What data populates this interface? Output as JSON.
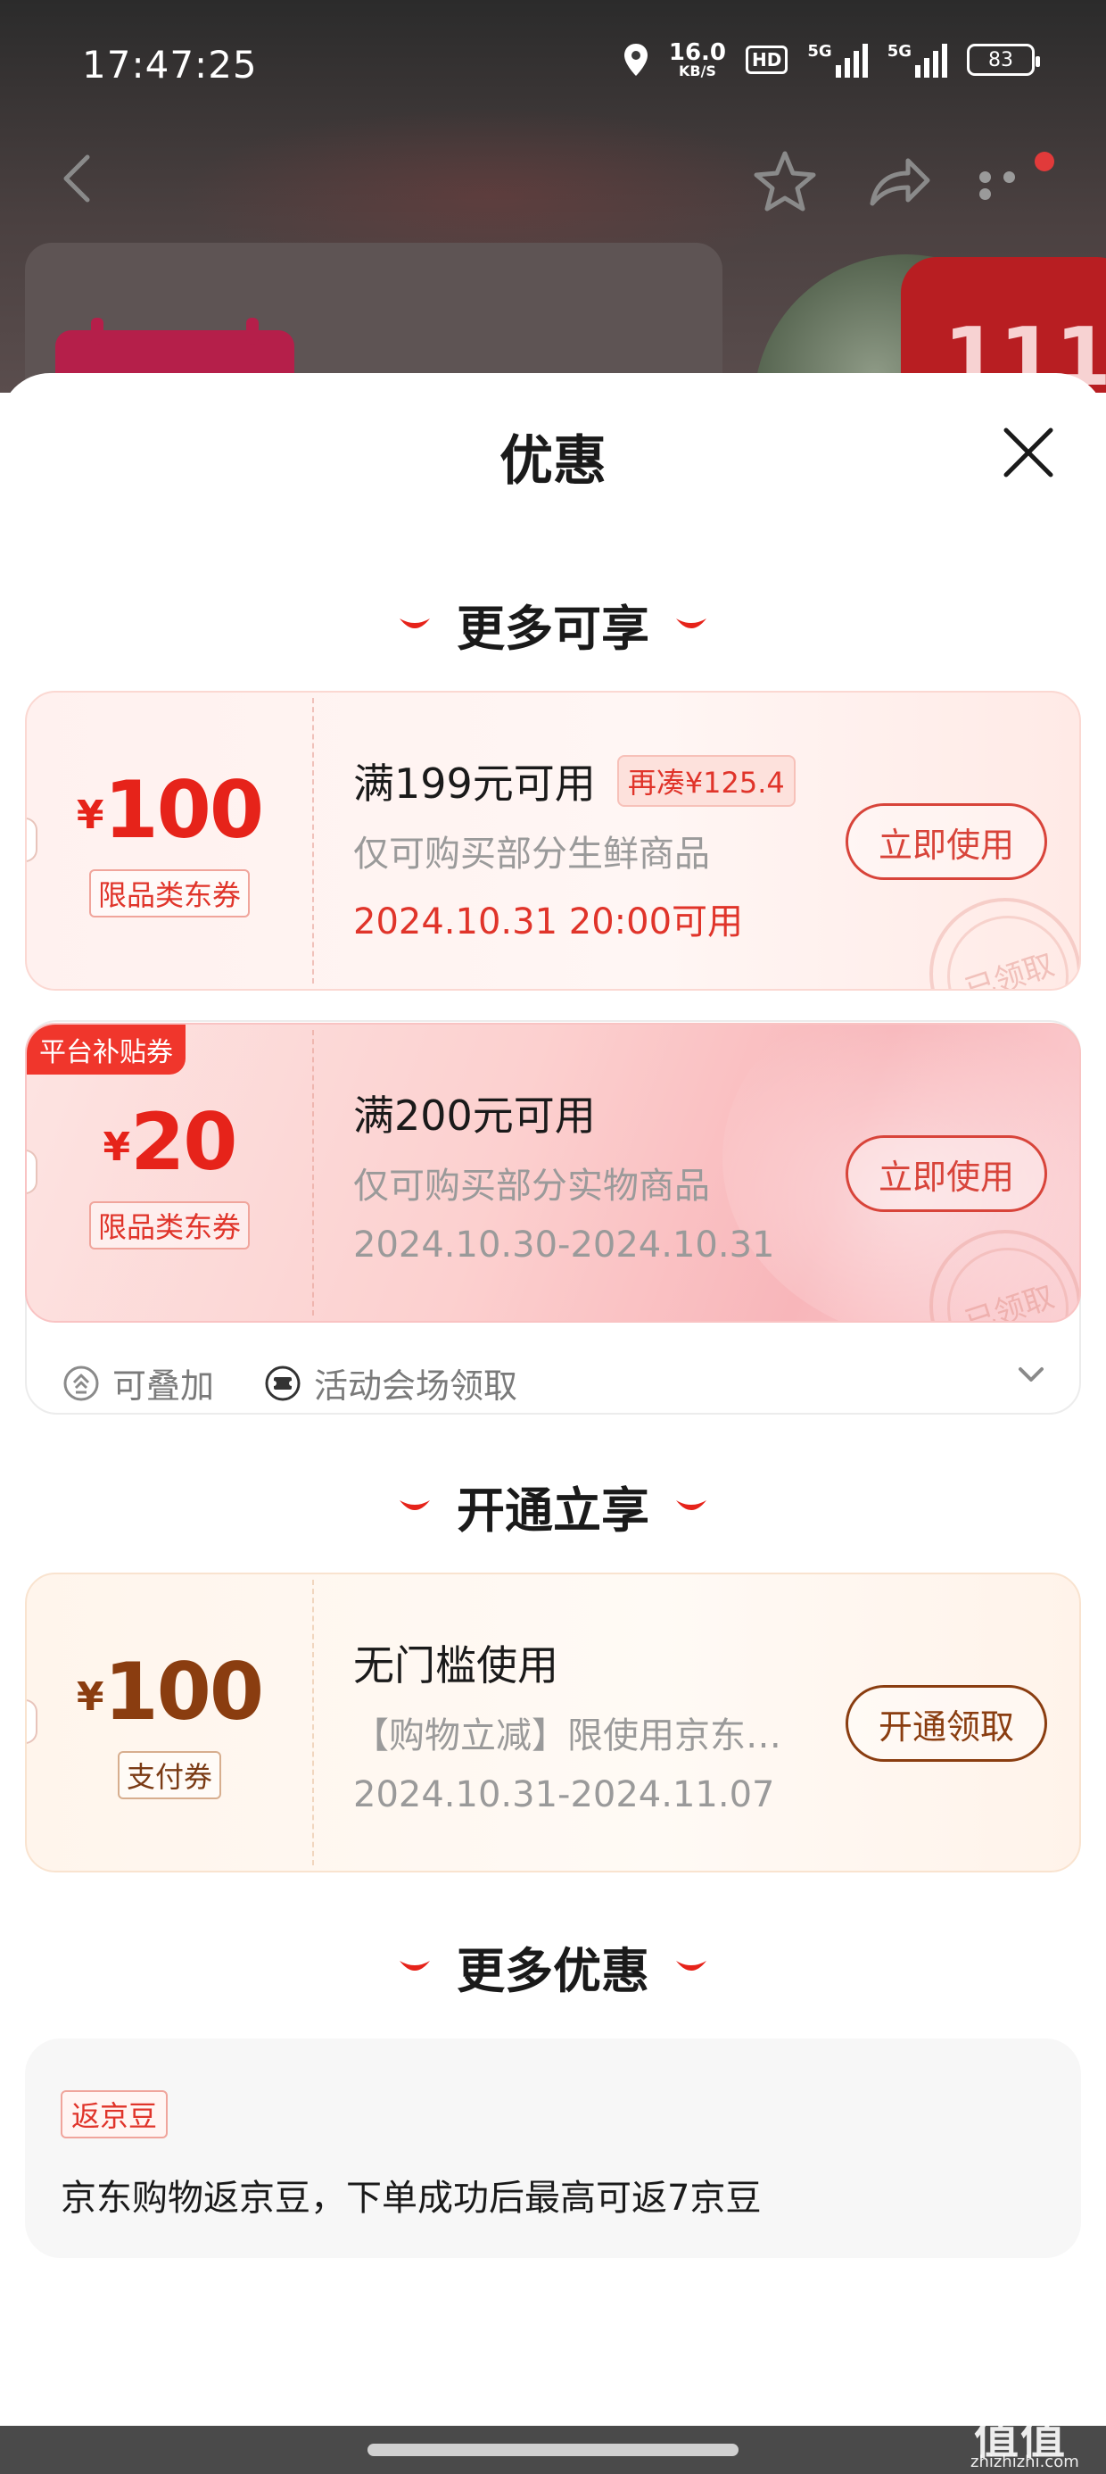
{
  "status_bar": {
    "time": "17:47:25",
    "net_speed_value": "16.0",
    "net_speed_unit": "KB/S",
    "hd": "HD",
    "signal1": "5G",
    "signal2": "5G",
    "battery": "83"
  },
  "background": {
    "promo_logo_text": "111"
  },
  "sheet": {
    "title": "优惠"
  },
  "sections": {
    "more_available": "更多可享",
    "open_enjoy": "开通立享",
    "more_discounts": "更多优惠"
  },
  "coupons": [
    {
      "yen": "¥",
      "amount": "100",
      "type": "限品类东券",
      "title": "满199元可用",
      "extra": "再凑¥125.4",
      "desc": "仅可购买部分生鲜商品",
      "date": "2024.10.31 20:00可用",
      "button": "立即使用",
      "stamp": "已领取"
    },
    {
      "corner_tag": "平台补贴券",
      "yen": "¥",
      "amount": "20",
      "type": "限品类东券",
      "title": "满200元可用",
      "desc": "仅可购买部分实物商品",
      "date": "2024.10.30-2024.10.31",
      "button": "立即使用",
      "stamp": "已领取"
    },
    {
      "yen": "¥",
      "amount": "100",
      "type": "支付券",
      "title": "无门槛使用",
      "desc": "【购物立减】限使用京东…",
      "date": "2024.10.31-2024.11.07",
      "button": "开通领取"
    }
  ],
  "stack_row": {
    "stackable": "可叠加",
    "claim_at_venue": "活动会场领取"
  },
  "more_card": {
    "tag": "返京豆",
    "text": "京东购物返京豆，下单成功后最高可返7京豆"
  },
  "watermark": {
    "mark": "值值值",
    "url": "zhizhizhi.com"
  },
  "colors": {
    "accent_red": "#e6231a",
    "gold_brown": "#8a3d10",
    "muted_gray": "#9a9a9a"
  },
  "icons": [
    "back-icon",
    "favorite-star-icon",
    "share-icon",
    "more-dots-icon",
    "close-icon",
    "stack-icon",
    "ticket-icon",
    "chevron-down-icon",
    "smile-arc-icon"
  ]
}
